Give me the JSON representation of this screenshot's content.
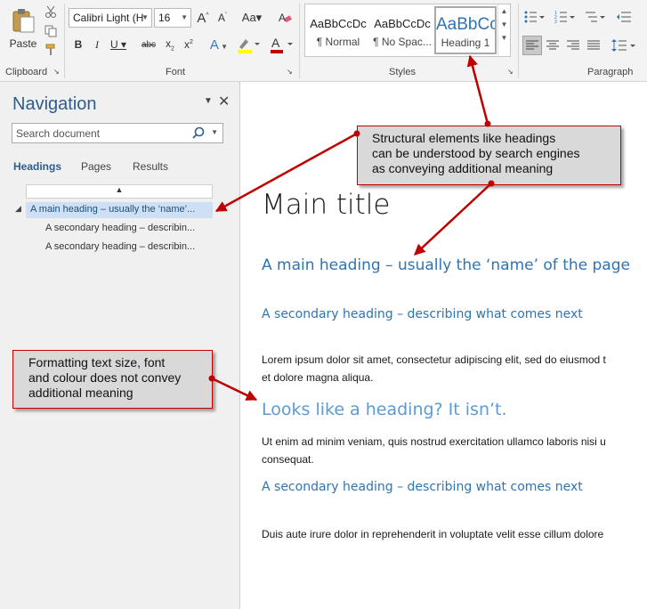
{
  "ribbon": {
    "clipboard": {
      "paste_label": "Paste",
      "group_label": "Clipboard"
    },
    "font": {
      "font_name": "Calibri Light (H",
      "font_size": "16",
      "group_label": "Font"
    },
    "styles": {
      "items": [
        {
          "sample": "AaBbCcDc",
          "name": "¶ Normal"
        },
        {
          "sample": "AaBbCcDc",
          "name": "¶ No Spac..."
        },
        {
          "sample": "AaBbCc",
          "name": "Heading 1"
        }
      ],
      "group_label": "Styles"
    },
    "paragraph": {
      "group_label": "Paragraph"
    }
  },
  "navigation": {
    "title": "Navigation",
    "search_placeholder": "Search document",
    "tabs": [
      "Headings",
      "Pages",
      "Results"
    ],
    "headings": [
      "A main heading – usually the ‘name’...",
      "A secondary heading – describin...",
      "A secondary heading – describin..."
    ]
  },
  "document": {
    "title": "Main title",
    "heading1": "A main heading – usually the ‘name’ of the page",
    "heading2a": "A secondary heading – describing what comes next",
    "para1_line1": "Lorem ipsum dolor sit amet, consectetur adipiscing elit, sed do eiusmod t",
    "para1_line2": "et dolore magna aliqua.",
    "fake_heading": "Looks like a heading? It isn’t.",
    "para2_line1": "Ut enim ad minim veniam, quis nostrud exercitation ullamco laboris nisi u",
    "para2_line2": "consequat.",
    "heading2b": "A secondary heading – describing what comes next",
    "para3_line1": "Duis aute irure dolor in reprehenderit in voluptate velit esse cillum dolore"
  },
  "callouts": {
    "structural": [
      "Structural elements like headings",
      "can be understood by search engines",
      "as conveying additional meaning"
    ],
    "formatting": [
      "Formatting text size, font",
      "and colour does not convey",
      "additional meaning"
    ]
  },
  "colors": {
    "heading_blue": "#2e74b5",
    "light_heading_blue": "#5b9bd5",
    "arrow_red": "#c00000",
    "nav_title_blue": "#2e5c8e",
    "callout_gray": "#d9d9d9"
  }
}
